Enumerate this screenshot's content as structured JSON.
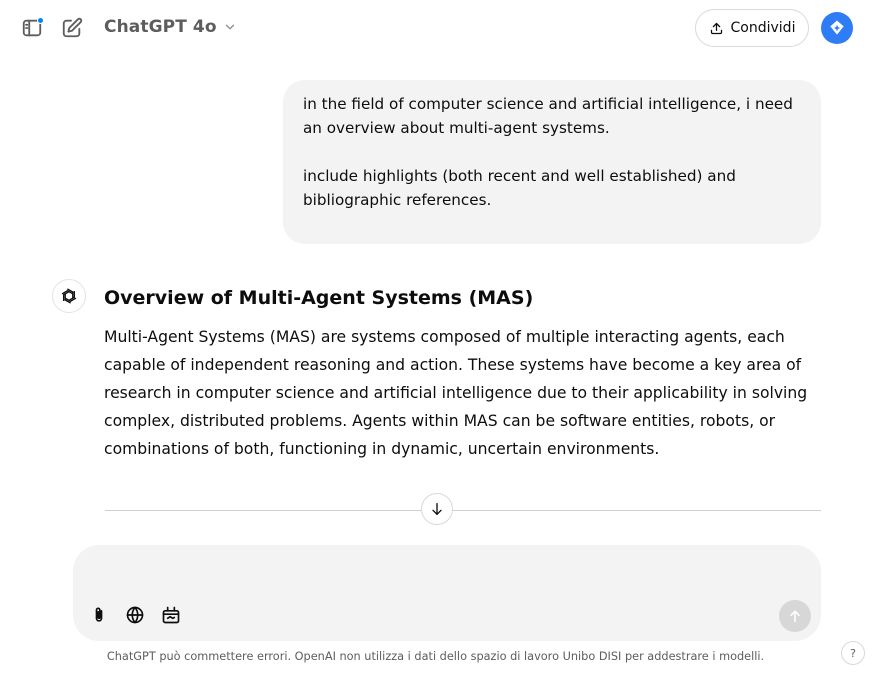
{
  "header": {
    "model_title": "ChatGPT 4o",
    "share_label": "Condividi",
    "icons": {
      "sidebar": "sidebar-toggle-icon",
      "new_chat": "edit-icon",
      "model_dropdown": "chevron-down-icon",
      "share": "upload-icon",
      "avatar": "sparkle-diamond-icon"
    },
    "notification_dot_color": "#0285ff",
    "avatar_color": "#2f7df6"
  },
  "conversation": {
    "user_message": "in the field of computer science and artificial intelligence, i need an overview about multi-agent systems.\n\ninclude highlights (both recent and well established) and bibliographic references.",
    "assistant": {
      "title": "Overview of Multi-Agent Systems (MAS)",
      "paragraph": "Multi-Agent Systems (MAS) are systems composed of multiple interacting agents, each capable of independent reasoning and action. These systems have become a key area of research in computer science and artificial intelligence due to their applicability in solving complex, distributed problems. Agents within MAS can be software entities, robots, or combinations of both, functioning in dynamic, uncertain environments.",
      "avatar_icon": "openai-logo-icon"
    },
    "scroll_down_icon": "arrow-down-icon"
  },
  "composer": {
    "placeholder": "",
    "tools": [
      "paperclip-icon",
      "globe-icon",
      "canvas-icon"
    ],
    "send_icon": "arrow-up-icon"
  },
  "footer": {
    "note": "ChatGPT può commettere errori. OpenAI non utilizza i dati dello spazio di lavoro Unibo DISI per addestrare i modelli.",
    "help_label": "?"
  }
}
